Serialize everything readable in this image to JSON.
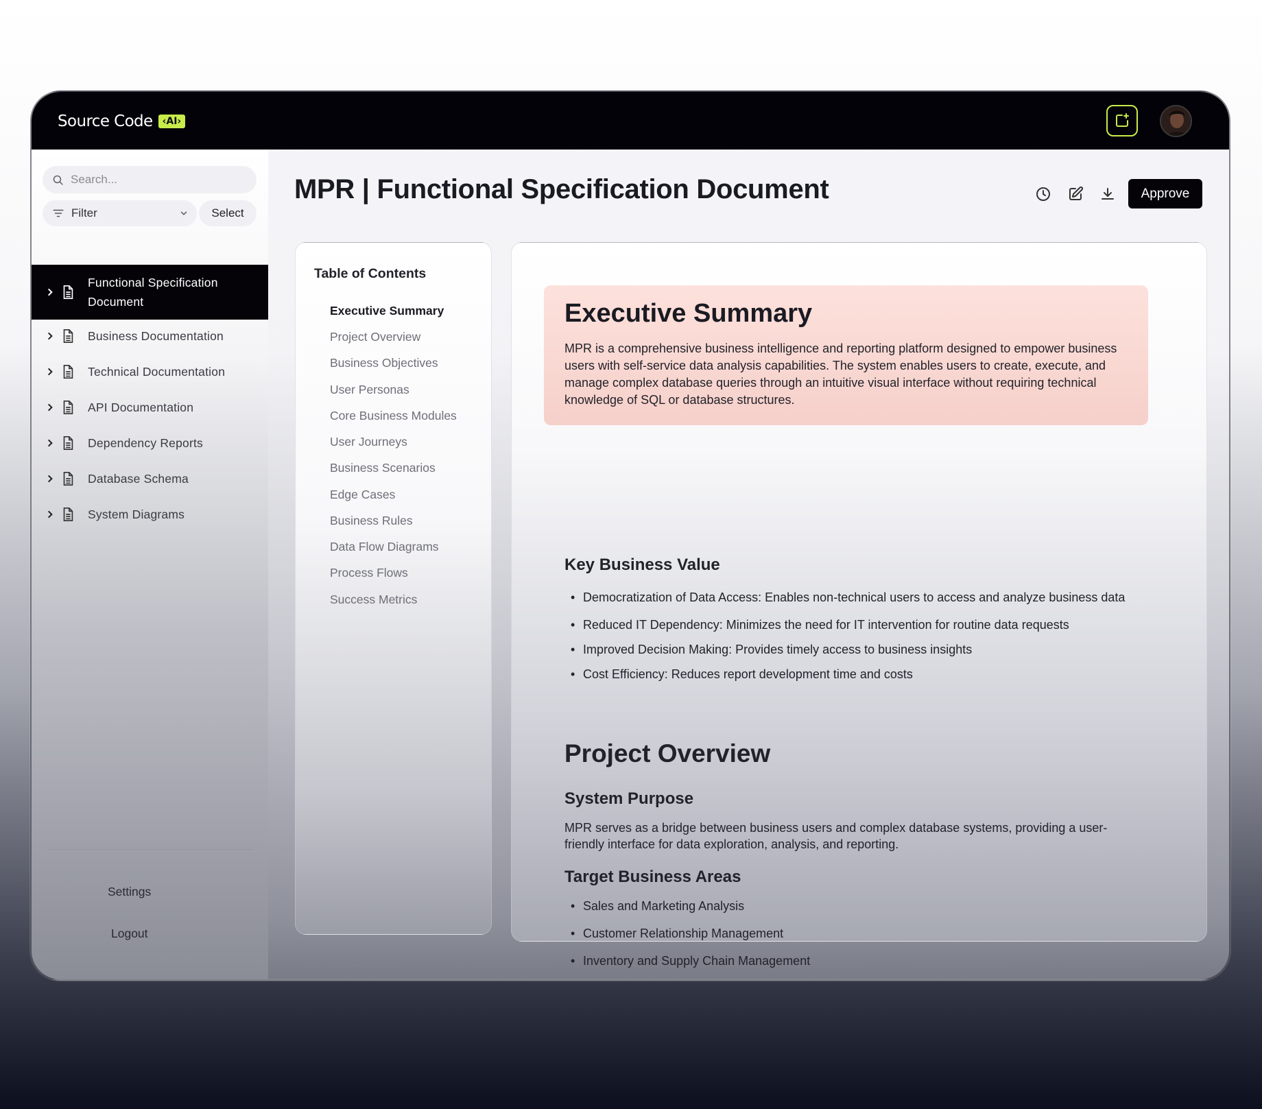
{
  "app": {
    "brand_name": "Source Code",
    "brand_badge": "‹AI›",
    "ai_button_icon": "sparkle-square-icon",
    "avatar_icon": "user-avatar",
    "colors": {
      "accent": "#c8ec4a",
      "topbar": "#030208",
      "highlight": "#fde1dc"
    }
  },
  "sidebar": {
    "search_placeholder": "Search...",
    "filter_label": "Filter",
    "select_label": "Select",
    "items": [
      {
        "label_line1": "Functional Specification",
        "label_line2": "Document",
        "active": true
      },
      {
        "label": "Business Documentation"
      },
      {
        "label": "Technical Documentation"
      },
      {
        "label": "API Documentation"
      },
      {
        "label": "Dependency Reports"
      },
      {
        "label": "Database Schema"
      },
      {
        "label": "System Diagrams"
      }
    ],
    "settings_label": "Settings",
    "logout_label": "Logout"
  },
  "header": {
    "title": "MPR | Functional Specification Document",
    "approve_label": "Approve",
    "icons": [
      "history-icon",
      "edit-icon",
      "download-icon"
    ]
  },
  "toc": {
    "title": "Table of Contents",
    "items": [
      "Executive Summary",
      "Project Overview",
      "Business Objectives",
      "User Personas",
      "Core Business Modules",
      "User Journeys",
      "Business Scenarios",
      "Edge Cases",
      "Business Rules",
      "Data Flow Diagrams",
      "Process Flows",
      "Success Metrics"
    ],
    "active_index": 0
  },
  "document": {
    "exec_title": "Executive Summary",
    "exec_body": "MPR is a comprehensive business intelligence and reporting platform designed to empower business users with self-service data analysis capabilities. The system enables users to create, execute, and manage complex database queries through an intuitive visual interface without requiring technical knowledge of SQL or database structures.",
    "kbv_title": "Key Business Value",
    "kbv_items": [
      "Democratization of Data Access: Enables non-technical users to access and analyze business data",
      "Reduced IT Dependency: Minimizes the need for IT intervention for routine data requests",
      "Improved Decision Making: Provides timely access to business insights",
      "Cost Efficiency: Reduces report development time and costs"
    ],
    "po_title": "Project Overview",
    "sp_title": "System Purpose",
    "sp_body": "MPR serves as a bridge between business users and complex database systems, providing a user-friendly interface for data exploration, analysis, and reporting.",
    "tba_title": "Target Business Areas",
    "tba_items": [
      "Sales and Marketing Analysis",
      "Customer Relationship Management",
      "Inventory and Supply Chain Management"
    ]
  }
}
